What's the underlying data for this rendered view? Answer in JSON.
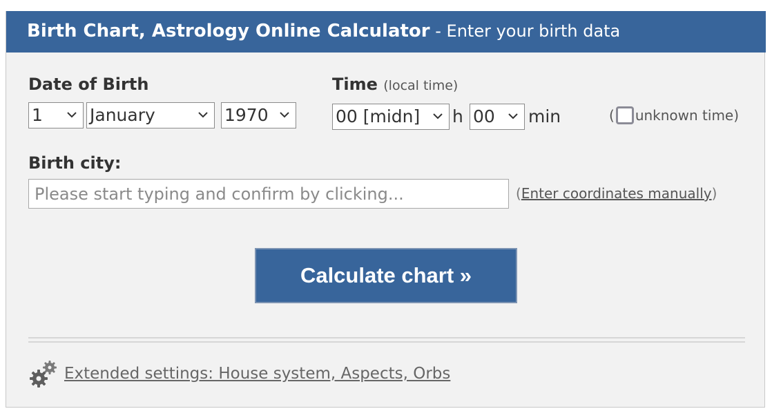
{
  "header": {
    "title": "Birth Chart, Astrology Online Calculator",
    "subtitle": " - Enter your birth data"
  },
  "date_of_birth": {
    "label": "Date of Birth",
    "day": "1",
    "month": "January",
    "year": "1970"
  },
  "time": {
    "label": "Time",
    "hint": "(local time)",
    "hour": "00 [midn]",
    "hour_unit": "h",
    "minute": "00",
    "minute_unit": "min",
    "unknown_open": "(",
    "unknown_label": "unknown time",
    "unknown_close": ")",
    "unknown_checked": false
  },
  "birth_city": {
    "label": "Birth city:",
    "placeholder": "Please start typing and confirm by clicking...",
    "value": "",
    "coords_open": "(",
    "coords_link": "Enter coordinates manually",
    "coords_close": ")"
  },
  "calculate_button": "Calculate chart »",
  "extended_settings": "Extended settings: House system, Aspects, Orbs",
  "icons": {
    "select_arrow": "chevron-down-icon",
    "settings": "gears-icon"
  },
  "colors": {
    "accent": "#38659b",
    "panel_bg": "#f2f2f2"
  }
}
